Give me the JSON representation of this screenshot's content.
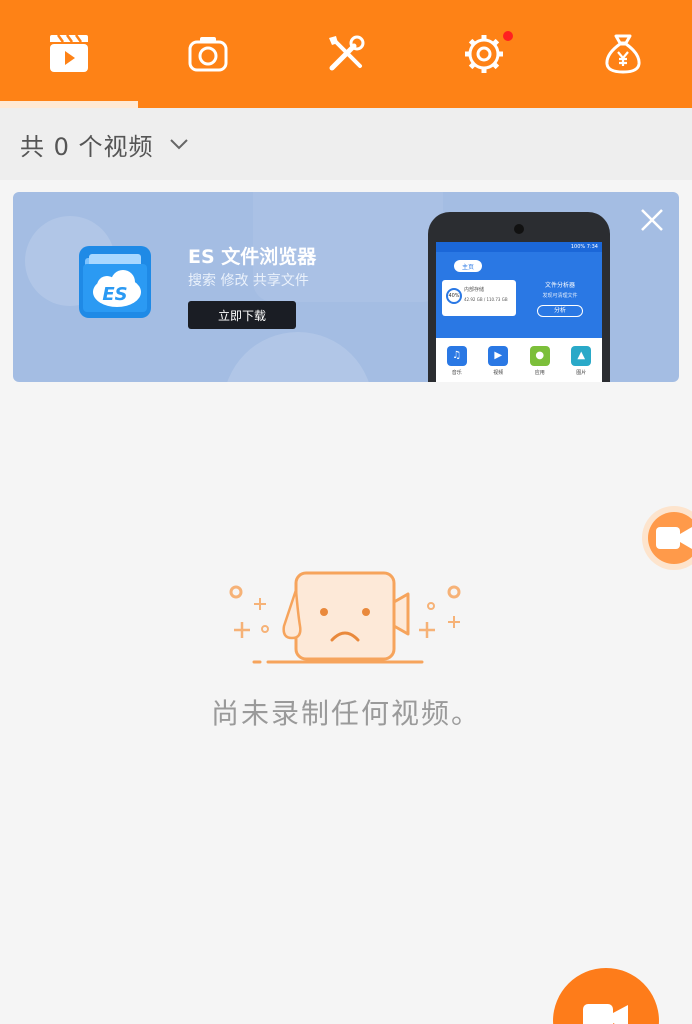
{
  "tabs": [
    {
      "name": "video-clapper-icon"
    },
    {
      "name": "camera-icon"
    },
    {
      "name": "tools-icon"
    },
    {
      "name": "gear-icon"
    },
    {
      "name": "money-bag-icon"
    }
  ],
  "colors": {
    "accent": "#fe8216",
    "badge": "#ff2020",
    "banner_bg": "#a4bde3"
  },
  "subheader": {
    "count_label": "共 0 个视频"
  },
  "banner": {
    "app_name": "ES 文件浏览器",
    "subtitle": "搜索 修改 共享文件",
    "download_label": "立即下载",
    "phone": {
      "status": "100% 7:34",
      "tab": "主页",
      "storage_label": "内部存储",
      "storage_percent": "40%",
      "storage_size": "42.92 GB / 110.73 GB",
      "analyzer_title": "文件分析器",
      "analyzer_sub": "发现可清理文件",
      "analyze_button": "分析",
      "grid": [
        "音乐",
        "视频",
        "应用",
        "图片"
      ]
    }
  },
  "empty": {
    "message": "尚未录制任何视频。"
  }
}
